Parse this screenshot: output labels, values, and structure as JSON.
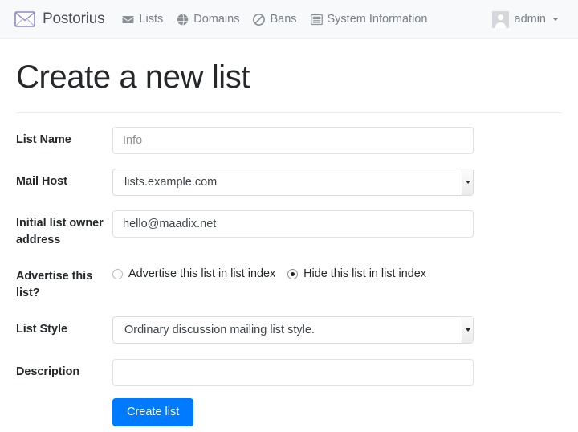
{
  "navbar": {
    "brand": {
      "name": "Postorius",
      "logo_icon": "envelope-logo-icon"
    },
    "links": [
      {
        "label": "Lists",
        "icon": "envelope-icon"
      },
      {
        "label": "Domains",
        "icon": "globe-icon"
      },
      {
        "label": "Bans",
        "icon": "ban-icon"
      },
      {
        "label": "System Information",
        "icon": "list-table-icon"
      }
    ],
    "user": {
      "name": "admin",
      "avatar_icon": "user-avatar-icon",
      "caret_icon": "caret-down-icon"
    }
  },
  "page": {
    "title": "Create a new list"
  },
  "form": {
    "fields": {
      "list_name": {
        "label": "List Name",
        "value": "",
        "placeholder": "Info"
      },
      "mail_host": {
        "label": "Mail Host",
        "selected": "lists.example.com"
      },
      "owner_address": {
        "label": "Initial list owner address",
        "value": "hello@maadix.net",
        "placeholder": ""
      },
      "advertise": {
        "label": "Advertise this list?",
        "options": [
          {
            "label": "Advertise this list in list index",
            "checked": false
          },
          {
            "label": "Hide this list in list index",
            "checked": true
          }
        ]
      },
      "list_style": {
        "label": "List Style",
        "selected": "Ordinary discussion mailing list style."
      },
      "description": {
        "label": "Description",
        "value": "",
        "placeholder": ""
      }
    },
    "submit_label": "Create list"
  },
  "colors": {
    "navbar_bg": "#f8f9fa",
    "primary": "#007bff",
    "logo_purple": "#7f7fb5",
    "muted_text": "#7a7f85"
  }
}
